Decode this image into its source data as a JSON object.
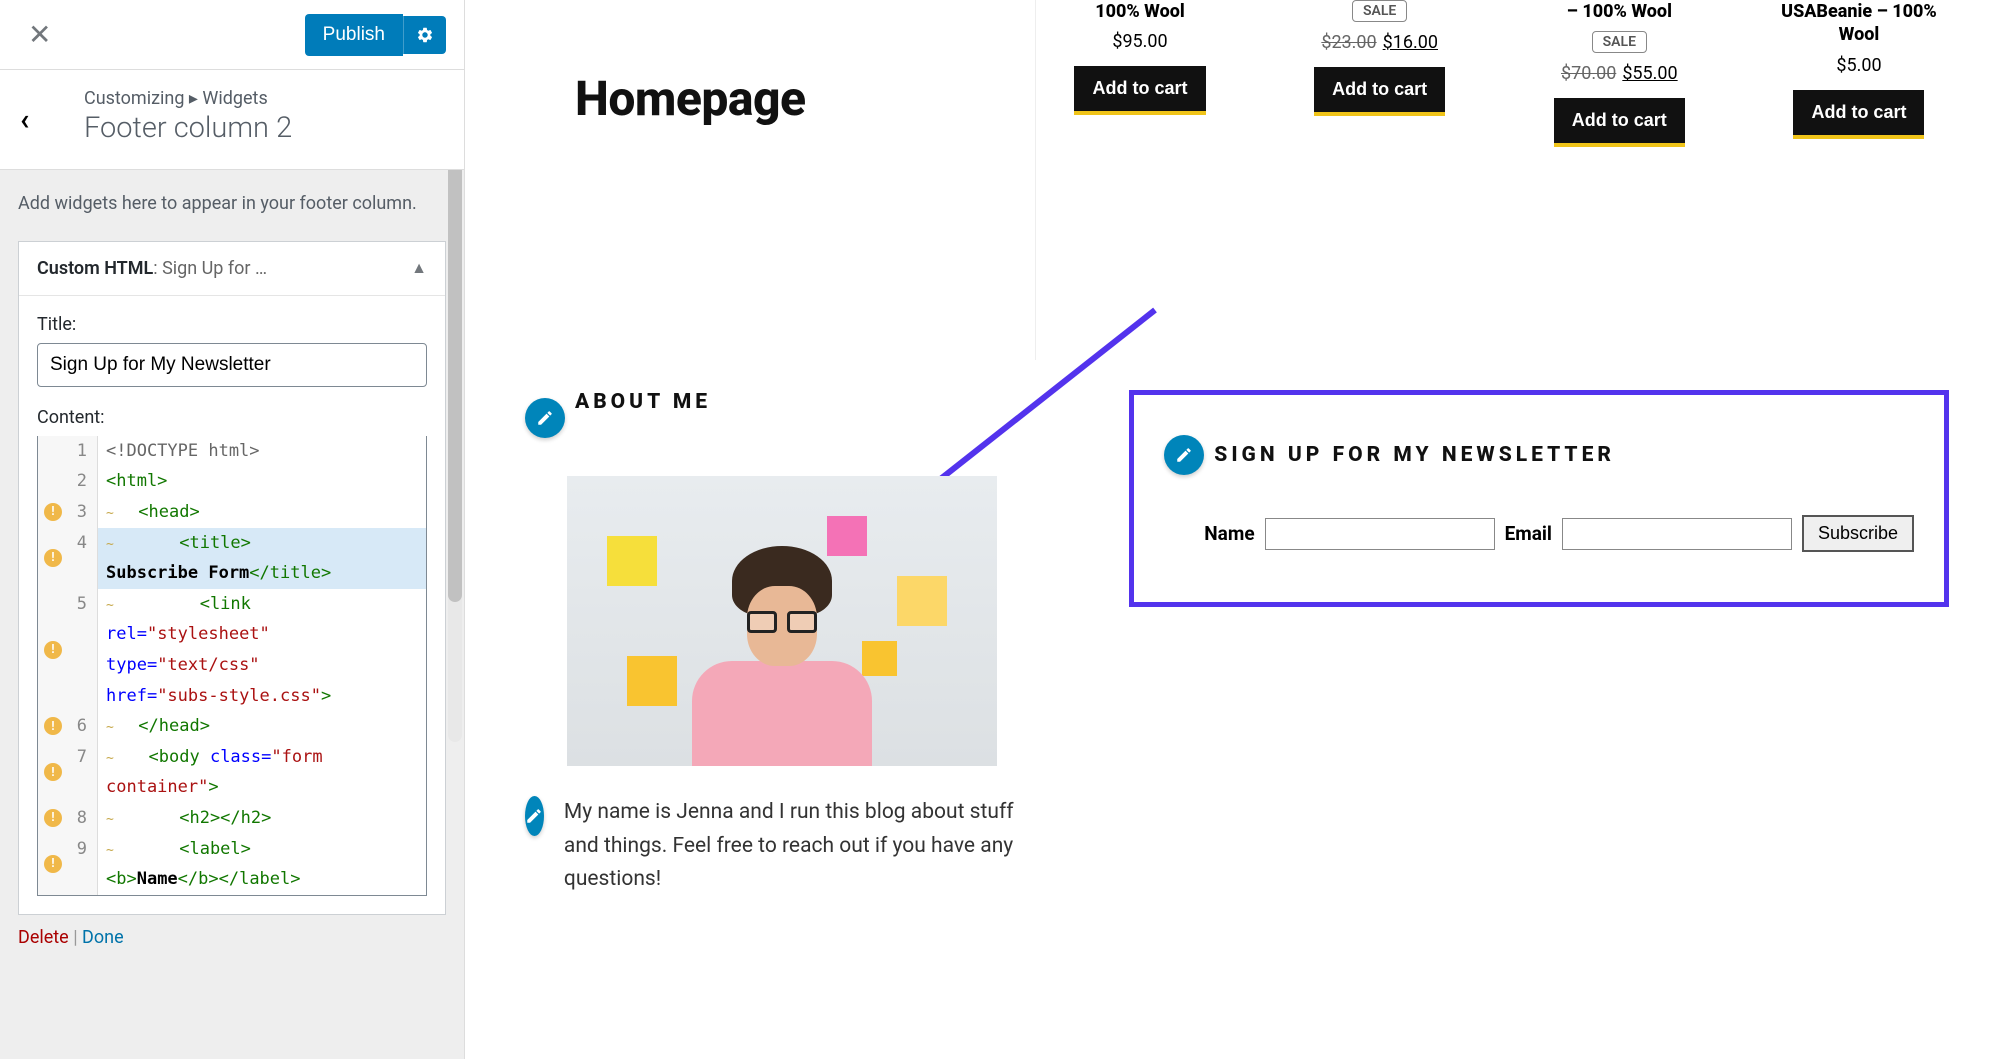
{
  "customizer": {
    "publish_label": "Publish",
    "breadcrumb_parent": "Customizing",
    "breadcrumb_child": "Widgets",
    "section_title": "Footer column 2",
    "help_text": "Add widgets here to appear in your footer column.",
    "widget": {
      "type_label": "Custom HTML",
      "name_truncated": "Sign Up for …",
      "title_field_label": "Title:",
      "title_value": "Sign Up for My Newsletter",
      "content_label": "Content:",
      "actions": {
        "delete": "Delete",
        "done": "Done"
      },
      "code_lines": [
        {
          "n": 1,
          "warn": false,
          "segments": [
            {
              "cls": "doctype",
              "t": "<!DOCTYPE html>"
            }
          ]
        },
        {
          "n": 2,
          "warn": false,
          "segments": [
            {
              "cls": "tag",
              "t": "<html>"
            }
          ]
        },
        {
          "n": 3,
          "warn": true,
          "segments": [
            {
              "cls": "tilde",
              "t": "~"
            },
            {
              "cls": "tag",
              "t": "  <head>"
            }
          ]
        },
        {
          "n": 4,
          "warn": true,
          "selected": true,
          "segments": [
            {
              "cls": "tilde",
              "t": "~"
            },
            {
              "cls": "tag",
              "t": "      <title>"
            },
            {
              "cls": "txt",
              "t": "\nSubscribe Form"
            },
            {
              "cls": "tag",
              "t": "</title>"
            }
          ]
        },
        {
          "n": 5,
          "warn": true,
          "segments": [
            {
              "cls": "tilde",
              "t": "~"
            },
            {
              "cls": "tag",
              "t": "        <link"
            },
            {
              "cls": "",
              "t": "\n"
            },
            {
              "cls": "attr",
              "t": "rel="
            },
            {
              "cls": "str",
              "t": "\"stylesheet\""
            },
            {
              "cls": "",
              "t": "\n"
            },
            {
              "cls": "attr",
              "t": "type="
            },
            {
              "cls": "str",
              "t": "\"text/css\""
            },
            {
              "cls": "",
              "t": "\n"
            },
            {
              "cls": "attr",
              "t": "href="
            },
            {
              "cls": "str",
              "t": "\"subs-style.css\""
            },
            {
              "cls": "tag",
              "t": ">"
            }
          ]
        },
        {
          "n": 6,
          "warn": true,
          "segments": [
            {
              "cls": "tilde",
              "t": "~"
            },
            {
              "cls": "tag",
              "t": "  </head>"
            }
          ]
        },
        {
          "n": 7,
          "warn": true,
          "segments": [
            {
              "cls": "tilde",
              "t": "~"
            },
            {
              "cls": "tag",
              "t": "   <body "
            },
            {
              "cls": "attr",
              "t": "class="
            },
            {
              "cls": "str",
              "t": "\"form\ncontainer\""
            },
            {
              "cls": "tag",
              "t": ">"
            }
          ]
        },
        {
          "n": 8,
          "warn": true,
          "segments": [
            {
              "cls": "tilde",
              "t": "~"
            },
            {
              "cls": "tag",
              "t": "      <h2></h2>"
            }
          ]
        },
        {
          "n": 9,
          "warn": true,
          "segments": [
            {
              "cls": "tilde",
              "t": "~"
            },
            {
              "cls": "tag",
              "t": "      <label>"
            },
            {
              "cls": "",
              "t": "\n"
            },
            {
              "cls": "tag",
              "t": "<b>"
            },
            {
              "cls": "txt",
              "t": "Name"
            },
            {
              "cls": "tag",
              "t": "</b></label>"
            }
          ]
        }
      ]
    }
  },
  "preview": {
    "page_title": "Homepage",
    "products": [
      {
        "name": "100% Wool",
        "price": "$95.00",
        "sale": false,
        "cta": "Add to cart"
      },
      {
        "name": "",
        "old": "$23.00",
        "new": "$16.00",
        "sale": true,
        "cta": "Add to cart"
      },
      {
        "name": "– 100% Wool",
        "old": "$70.00",
        "new": "$55.00",
        "sale": true,
        "cta": "Add to cart"
      },
      {
        "name": "USABeanie – 100% Wool",
        "price": "$5.00",
        "sale": false,
        "cta": "Add to cart"
      }
    ],
    "about": {
      "heading": "ABOUT ME",
      "text": "My name is Jenna and I run this blog about stuff and things. Feel free to reach out if you have any questions!"
    },
    "newsletter": {
      "heading": "SIGN UP FOR MY NEWSLETTER",
      "name_label": "Name",
      "email_label": "Email",
      "submit": "Subscribe"
    }
  }
}
